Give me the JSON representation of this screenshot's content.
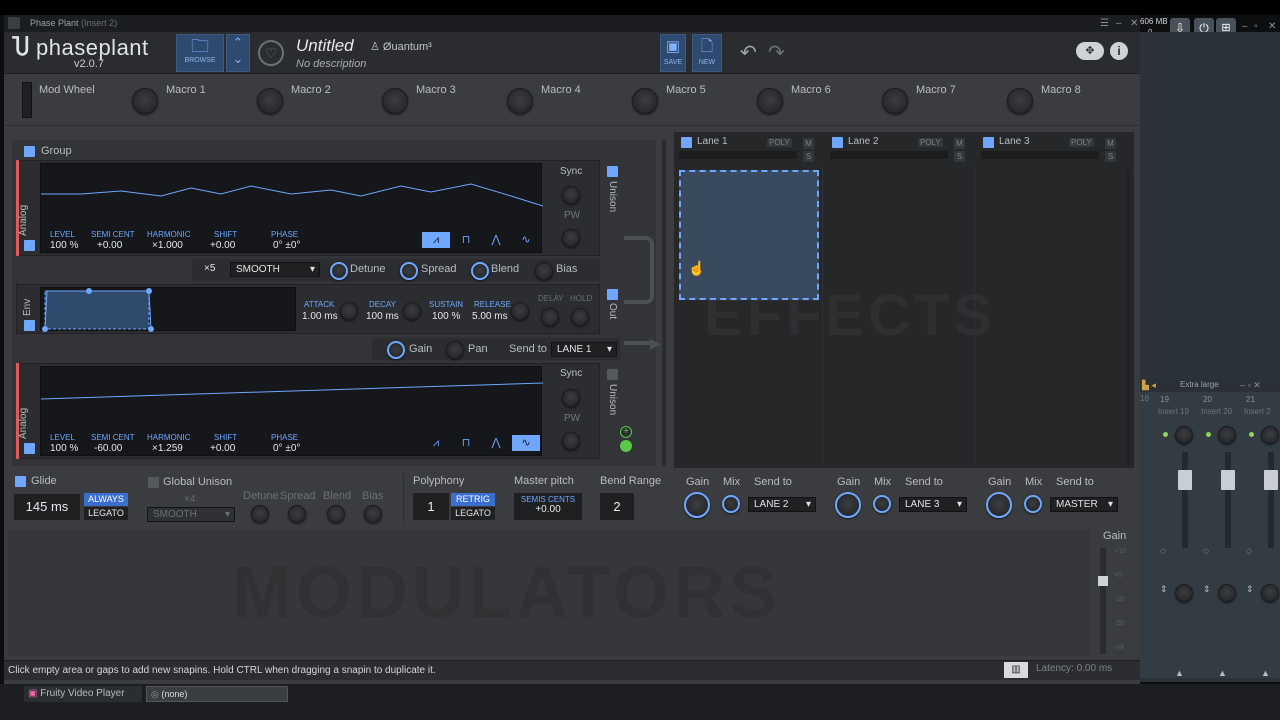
{
  "window": {
    "title": "Phase Plant",
    "insert": "(Insert 2)"
  },
  "sys": {
    "mem": "606 MB",
    "mem2": "0"
  },
  "header": {
    "logo": "phaseplant",
    "version": "v2.0.7",
    "browse": "BROWSE",
    "preset_name": "Untitled",
    "preset_desc": "No description",
    "author": "Øuantum³",
    "save": "SAVE",
    "new": "NEW"
  },
  "macros": {
    "mod_wheel": "Mod Wheel",
    "items": [
      "Macro 1",
      "Macro 2",
      "Macro 3",
      "Macro 4",
      "Macro 5",
      "Macro 6",
      "Macro 7",
      "Macro 8"
    ]
  },
  "group": {
    "label": "Group"
  },
  "osc1": {
    "type": "Analog",
    "level_l": "LEVEL",
    "level": "100 %",
    "semi_l": "SEMI CENT",
    "semi": "+0.00",
    "harm_l": "HARMONIC",
    "harm": "×1.000",
    "shift_l": "SHIFT",
    "shift": "+0.00",
    "phase_l": "PHASE",
    "phase": "0° ±0°",
    "sync": "Sync",
    "pw": "PW",
    "unison": "Unison"
  },
  "unison_row": {
    "voices": "×5",
    "mode": "SMOOTH",
    "detune": "Detune",
    "spread": "Spread",
    "blend": "Blend",
    "bias": "Bias"
  },
  "env": {
    "label": "Env",
    "attack_l": "ATTACK",
    "attack": "1.00 ms",
    "decay_l": "DECAY",
    "decay": "100 ms",
    "sustain_l": "SUSTAIN",
    "sustain": "100 %",
    "release_l": "RELEASE",
    "release": "5.00 ms",
    "delay_l": "DELAY",
    "hold_l": "HOLD",
    "out": "Out"
  },
  "output": {
    "gain": "Gain",
    "pan": "Pan",
    "send_to": "Send to",
    "lane": "LANE 1"
  },
  "osc2": {
    "type": "Analog",
    "level_l": "LEVEL",
    "level": "100 %",
    "semi_l": "SEMI CENT",
    "semi": "-60.00",
    "harm_l": "HARMONIC",
    "harm": "×1.259",
    "shift_l": "SHIFT",
    "shift": "+0.00",
    "phase_l": "PHASE",
    "phase": "0° ±0°",
    "sync": "Sync",
    "pw": "PW",
    "unison": "Unison"
  },
  "lanes": [
    {
      "name": "Lane 1",
      "poly": "POLY",
      "m": "M",
      "s": "S",
      "send": "LANE 2"
    },
    {
      "name": "Lane 2",
      "poly": "POLY",
      "m": "M",
      "s": "S",
      "send": "LANE 3"
    },
    {
      "name": "Lane 3",
      "poly": "POLY",
      "m": "M",
      "s": "S",
      "send": "MASTER"
    }
  ],
  "lane_ctrl": {
    "gain": "Gain",
    "mix": "Mix",
    "send_to": "Send to"
  },
  "effects_wm": "EFFECTS",
  "bottom": {
    "glide": "Glide",
    "glide_val": "145 ms",
    "always": "ALWAYS",
    "legato": "LEGATO",
    "global_unison": "Global Unison",
    "gu_voices": "×4",
    "gu_mode": "SMOOTH",
    "gu_detune": "Detune",
    "gu_spread": "Spread",
    "gu_blend": "Blend",
    "gu_bias": "Bias",
    "polyphony": "Polyphony",
    "poly_val": "1",
    "retrig": "RETRIG",
    "legato2": "LEGATO",
    "master_pitch": "Master pitch",
    "semis_cents": "SEMIS CENTS",
    "mp_val": "+0.00",
    "bend_range": "Bend Range",
    "bend_val": "2"
  },
  "modulators_wm": "MODULATORS",
  "gain_panel": {
    "label": "Gain",
    "ticks": [
      "+10",
      "+0",
      "-10",
      "-20",
      "-inf"
    ]
  },
  "status": {
    "hint": "Click empty area or gaps to add new snapins. Hold CTRL when dragging a snapin to duplicate it.",
    "latency": "Latency: 0.00 ms"
  },
  "mixer": {
    "title": "Extra large",
    "inserts": [
      {
        "n": "19",
        "l": "Insert 19"
      },
      {
        "n": "20",
        "l": "Insert 20"
      },
      {
        "n": "21",
        "l": "Insert 2"
      }
    ],
    "left_n": "18"
  },
  "taskbar": {
    "app": "Fruity Video Player",
    "field": "(none)"
  }
}
